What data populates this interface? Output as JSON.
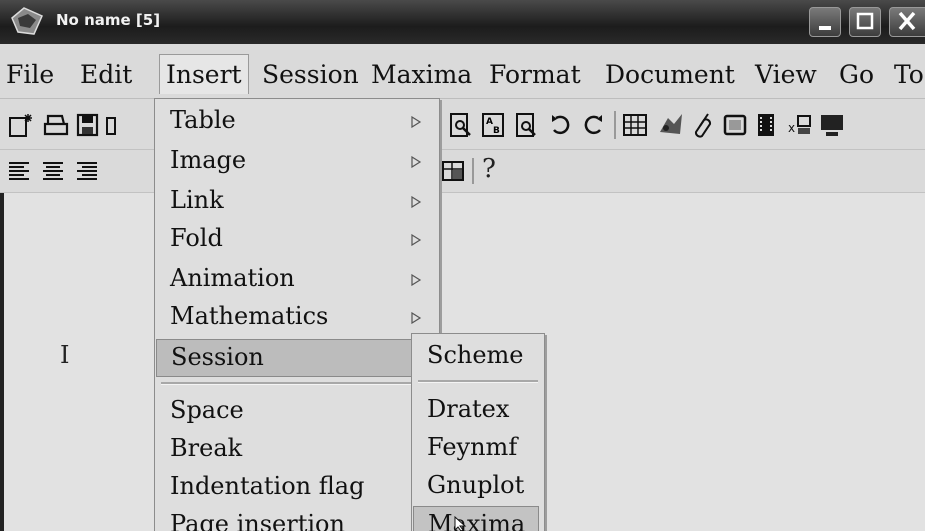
{
  "window": {
    "title": "No name [5]"
  },
  "menubar": [
    {
      "label": "File"
    },
    {
      "label": "Edit"
    },
    {
      "label": "Insert"
    },
    {
      "label": "Session"
    },
    {
      "label": "Maxima"
    },
    {
      "label": "Format"
    },
    {
      "label": "Document"
    },
    {
      "label": "View"
    },
    {
      "label": "Go"
    },
    {
      "label": "To"
    }
  ],
  "insert_menu": {
    "items": [
      {
        "label": "Table",
        "submenu": true
      },
      {
        "label": "Image",
        "submenu": true
      },
      {
        "label": "Link",
        "submenu": true
      },
      {
        "label": "Fold",
        "submenu": true
      },
      {
        "label": "Animation",
        "submenu": true
      },
      {
        "label": "Mathematics",
        "submenu": true
      },
      {
        "label": "Session",
        "submenu": true,
        "highlighted": true
      },
      {
        "label": "Space"
      },
      {
        "label": "Break"
      },
      {
        "label": "Indentation flag"
      },
      {
        "label": "Page insertion"
      }
    ]
  },
  "session_submenu": {
    "items": [
      {
        "label": "Scheme"
      },
      {
        "label": "Dratex"
      },
      {
        "label": "Feynmf"
      },
      {
        "label": "Gnuplot"
      },
      {
        "label": "Maxima",
        "highlighted": true
      }
    ]
  },
  "toolbar2": {
    "help_glyph": "?"
  },
  "document": {
    "text_cursor": "I"
  },
  "icons": {
    "toolbar1": [
      "new-document-icon",
      "open-icon",
      "save-icon",
      "print-preview-icon",
      "page-text-icon",
      "find-icon",
      "undo-icon",
      "redo-icon",
      "table-icon",
      "image-icon",
      "link-icon",
      "frame-icon",
      "animation-icon",
      "macro-icon",
      "session-icon"
    ],
    "toolbar2": [
      "align-left-icon",
      "align-center-icon",
      "align-right-icon",
      "table-format-icon",
      "help-icon"
    ]
  }
}
